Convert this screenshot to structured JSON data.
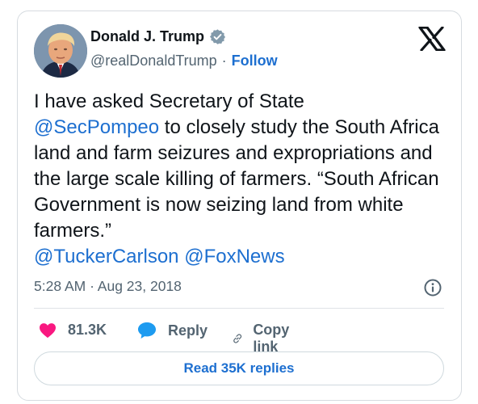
{
  "author": {
    "display_name": "Donald J. Trump",
    "handle": "@realDonaldTrump",
    "separator": "·",
    "follow_label": "Follow",
    "verified_color": "#829aab"
  },
  "tweet": {
    "text_before": "I have asked Secretary of State",
    "mention_1": "@SecPompeo",
    "text_middle": " to closely study the South Africa land and farm seizures and expropriations and the large scale killing of farmers. “South African Government is now seizing land from white farmers.”",
    "mention_2": "@TuckerCarlson",
    "mention_3": "@FoxNews",
    "timestamp": "5:28 AM · Aug 23, 2018"
  },
  "actions": {
    "like_count": "81.3K",
    "reply_label": "Reply",
    "copy_label": "Copy link"
  },
  "read_replies_label": "Read 35K replies",
  "colors": {
    "link": "#1d6fd0",
    "like": "#f91880",
    "reply_icon": "#1d9bf0",
    "text": "#0f1419",
    "secondary": "#536471"
  },
  "icons": {
    "brand": "x-logo-icon",
    "verified": "verified-badge-icon",
    "info": "info-icon",
    "like": "heart-icon",
    "reply": "speech-bubble-icon",
    "copy": "link-icon"
  }
}
